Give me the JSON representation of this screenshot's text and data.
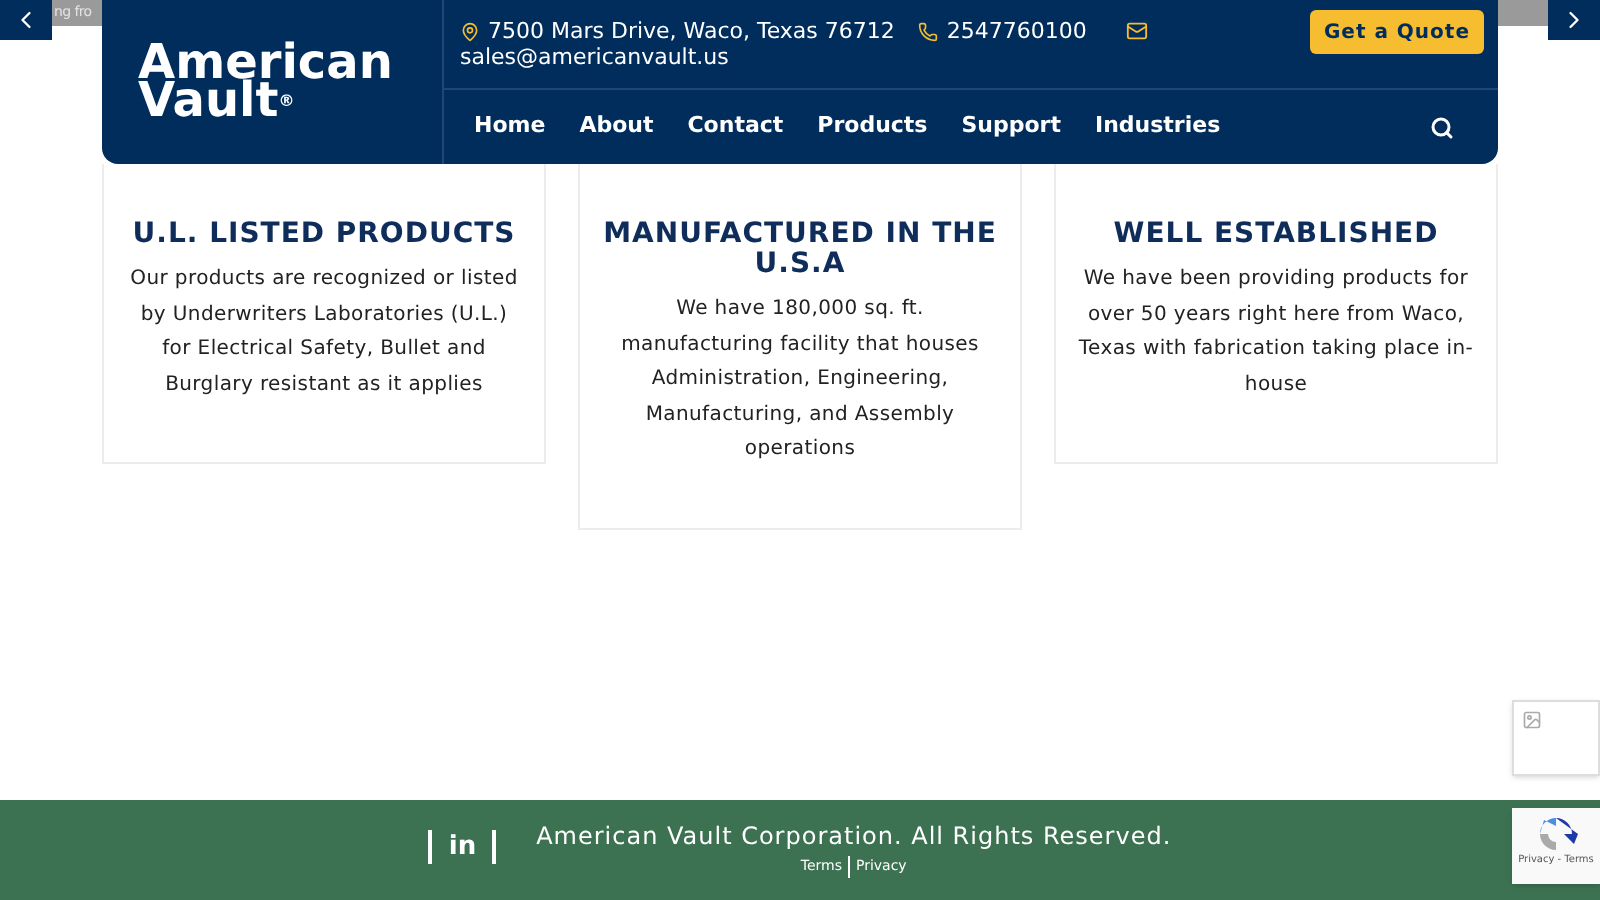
{
  "topbar": {
    "text": "ng fro"
  },
  "logo": {
    "line1": "American",
    "line2": "Vault",
    "mark": "®"
  },
  "contact": {
    "address": "7500 Mars Drive, Waco, Texas 76712",
    "phone": "2547760100",
    "email": "sales@americanvault.us"
  },
  "quote_button": "Get a Quote",
  "nav": [
    "Home",
    "About",
    "Contact",
    "Products",
    "Support",
    "Industries"
  ],
  "features": [
    {
      "title": "U.L. LISTED PRODUCTS",
      "text": "Our products are recognized or listed by Underwriters Laboratories (U.L.) for Electrical Safety, Bullet and Burglary resistant as it applies"
    },
    {
      "title": "MANUFACTURED IN THE U.S.A",
      "text": "We have 180,000 sq. ft. manufacturing facility that houses Administration, Engineering, Manufacturing, and Assembly operations"
    },
    {
      "title": "WELL ESTABLISHED",
      "text": "We have been providing products for over 50 years right here from Waco, Texas with fabrication taking place in-house"
    }
  ],
  "footer": {
    "social": "in",
    "copyright": "American Vault Corporation. All Rights Reserved.",
    "links": [
      "Terms",
      "Privacy"
    ]
  },
  "recaptcha": {
    "text": "Privacy - Terms"
  }
}
